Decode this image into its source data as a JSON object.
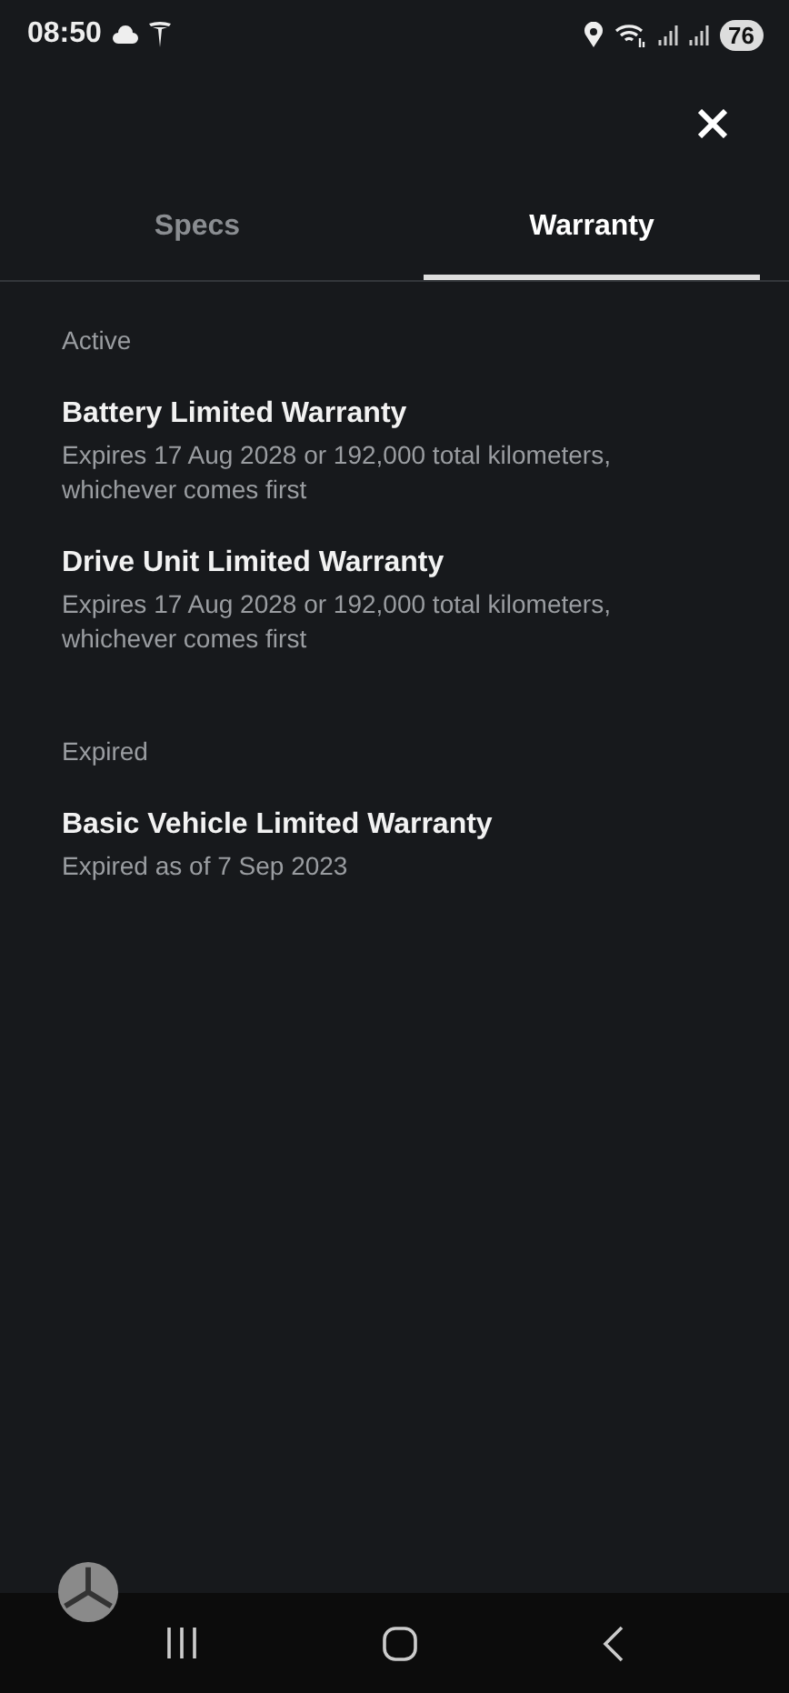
{
  "status_bar": {
    "time": "08:50",
    "battery": "76"
  },
  "tabs": [
    {
      "label": "Specs",
      "selected": false
    },
    {
      "label": "Warranty",
      "selected": true
    }
  ],
  "sections": [
    {
      "title": "Active",
      "items": [
        {
          "name": "Battery Limited Warranty",
          "detail": "Expires 17 Aug 2028 or 192,000 total kilometers, whichever comes first"
        },
        {
          "name": "Drive Unit Limited Warranty",
          "detail": "Expires 17 Aug 2028 or 192,000 total kilometers, whichever comes first"
        }
      ]
    },
    {
      "title": "Expired",
      "items": [
        {
          "name": "Basic Vehicle Limited Warranty",
          "detail": "Expired as of 7 Sep 2023"
        }
      ]
    }
  ]
}
